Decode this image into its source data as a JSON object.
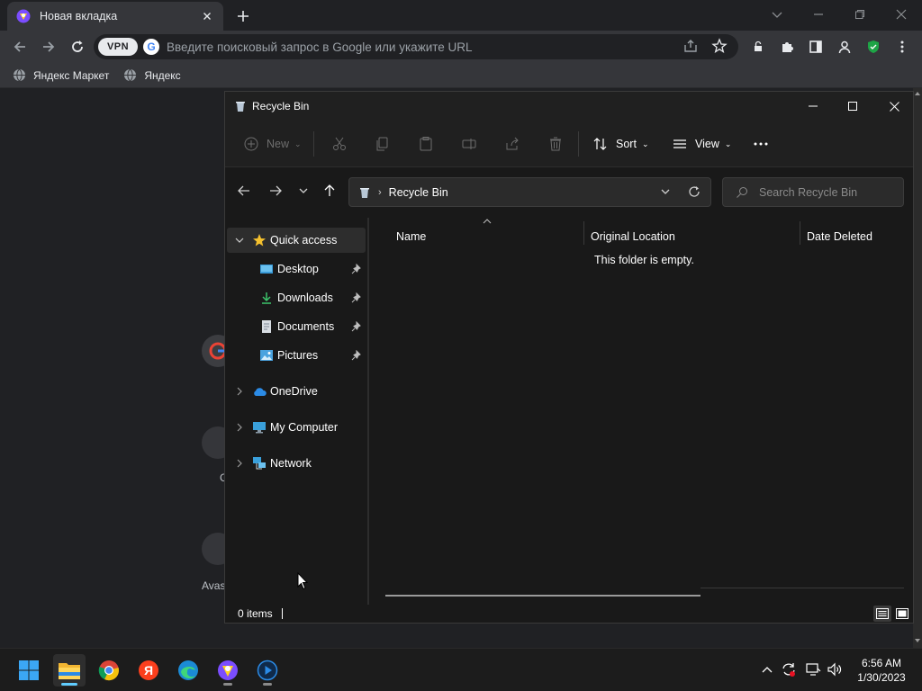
{
  "browser": {
    "tab_title": "Новая вкладка",
    "omnibox_placeholder": "Введите поисковый запрос в Google или укажите URL",
    "vpn_label": "VPN",
    "bookmarks": [
      {
        "label": "Яндекс Маркет",
        "icon": "globe-icon"
      },
      {
        "label": "Яндекс",
        "icon": "globe-icon"
      }
    ],
    "newtab_labels": [
      "G",
      "Avas"
    ]
  },
  "explorer": {
    "window_title": "Recycle Bin",
    "commands": {
      "new": "New",
      "sort": "Sort",
      "view": "View"
    },
    "address": "Recycle Bin",
    "search_placeholder": "Search Recycle Bin",
    "nav_tree": [
      {
        "label": "Quick access",
        "icon": "star-icon",
        "selected": true
      },
      {
        "label": "Desktop",
        "icon": "desktop-icon",
        "pinned": true
      },
      {
        "label": "Downloads",
        "icon": "download-icon",
        "pinned": true
      },
      {
        "label": "Documents",
        "icon": "document-icon",
        "pinned": true
      },
      {
        "label": "Pictures",
        "icon": "pictures-icon",
        "pinned": true
      },
      {
        "label": "OneDrive",
        "icon": "cloud-icon"
      },
      {
        "label": "My Computer",
        "icon": "computer-icon"
      },
      {
        "label": "Network",
        "icon": "network-icon"
      }
    ],
    "columns": [
      "Name",
      "Original Location",
      "Date Deleted"
    ],
    "empty_message": "This folder is empty.",
    "status": "0 items"
  },
  "taskbar": {
    "apps": [
      "start-icon",
      "file-explorer-icon",
      "chrome-icon",
      "yandex-icon",
      "edge-icon",
      "browser-icon",
      "media-player-icon"
    ],
    "time": "6:56 AM",
    "date": "1/30/2023"
  },
  "colors": {
    "accent": "#60cdff",
    "explorer_bg": "#191919",
    "chrome_bg": "#35363a"
  }
}
